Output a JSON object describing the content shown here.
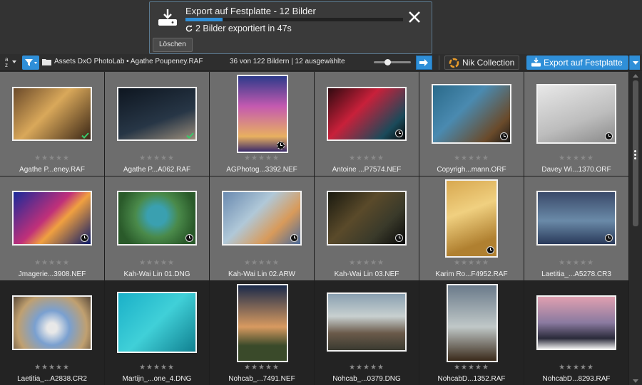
{
  "export_panel": {
    "title": "Export auf Festplatte - 12 Bilder",
    "progress": 0.17,
    "status": "2 Bilder exportiert in 47s",
    "clear_label": "Löschen",
    "icons": [
      "hard-disk-icon",
      "close-icon",
      "refresh-icon"
    ]
  },
  "toolbar": {
    "sort_top": "a",
    "sort_bottom": "z",
    "path": "Assets DxO PhotoLab  •  Agathe Poupeney.RAF",
    "count": "36 von 122 Bildern | 12 ausgewählte",
    "zoom": 0.35,
    "nik_label": "Nik Collection",
    "export_label": "Export auf Festplatte"
  },
  "thumbnails": [
    {
      "name": "Agathe P...eney.RAF",
      "badge": "check",
      "selected": true
    },
    {
      "name": "Agathe P...A062.RAF",
      "badge": "check",
      "selected": true
    },
    {
      "name": "AGPhotog...3392.NEF",
      "badge": "pending",
      "selected": true
    },
    {
      "name": "Antoine ...P7574.NEF",
      "badge": "clock",
      "selected": true
    },
    {
      "name": "Copyrigh...mann.ORF",
      "badge": "clock",
      "selected": true
    },
    {
      "name": "Davey Wi...1370.ORF",
      "badge": "clock",
      "selected": true
    },
    {
      "name": "Jmagerie...3908.NEF",
      "badge": "clock",
      "selected": true
    },
    {
      "name": "Kah-Wai Lin 01.DNG",
      "badge": "clock",
      "selected": true
    },
    {
      "name": "Kah-Wai Lin 02.ARW",
      "badge": "clock",
      "selected": true
    },
    {
      "name": "Kah-Wai Lin 03.NEF",
      "badge": "clock",
      "selected": true
    },
    {
      "name": "Karim Ro...F4952.RAF",
      "badge": "clock",
      "selected": true
    },
    {
      "name": "Laetitia_...A5278.CR3",
      "badge": "clock",
      "selected": true
    },
    {
      "name": "Laetitia_...A2838.CR2",
      "badge": "",
      "selected": false
    },
    {
      "name": "Martijn_...one_4.DNG",
      "badge": "",
      "selected": false
    },
    {
      "name": "Nohcab_...7491.NEF",
      "badge": "",
      "selected": false
    },
    {
      "name": "Nohcab_...0379.DNG",
      "badge": "",
      "selected": false
    },
    {
      "name": "NohcabD...1352.RAF",
      "badge": "",
      "selected": false
    },
    {
      "name": "NohcabD...8293.RAF",
      "badge": "",
      "selected": false
    }
  ],
  "rating_glyphs": "★★★★★",
  "colors": {
    "accent": "#2f8fd8",
    "selected_cell": "#6d6d6d",
    "unselected_cell": "#232323",
    "check": "#38c96a"
  }
}
